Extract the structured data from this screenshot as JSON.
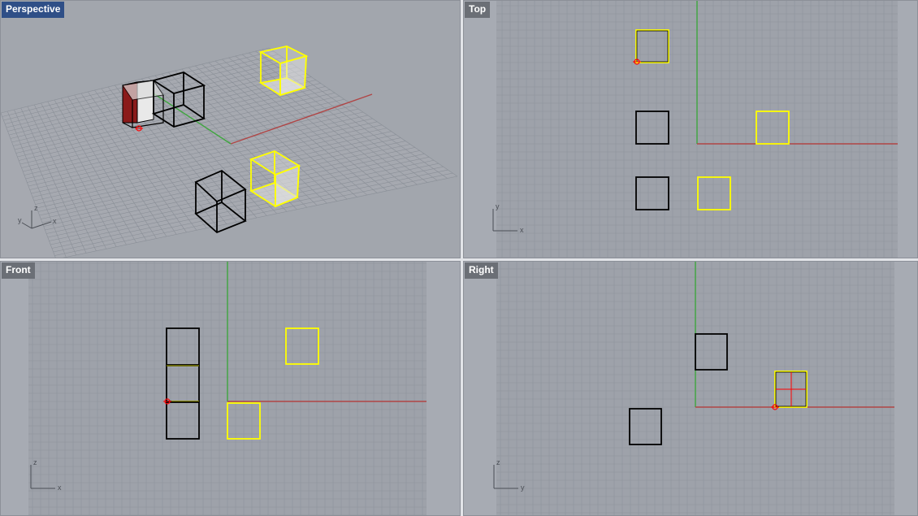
{
  "viewports": {
    "perspective": {
      "title": "Perspective",
      "active": true
    },
    "top": {
      "title": "Top"
    },
    "front": {
      "title": "Front"
    },
    "right": {
      "title": "Right"
    }
  },
  "axis_labels": {
    "perspective": {
      "a": "z",
      "b": "y",
      "c": "x"
    },
    "top": {
      "a": "y",
      "b": "x"
    },
    "front": {
      "a": "z",
      "b": "x"
    },
    "right": {
      "a": "z",
      "b": "y"
    }
  },
  "colors": {
    "grid_line": "#8e939b",
    "grid_major": "#80858d",
    "x_axis": "#b04545",
    "y_axis": "#3ea63e",
    "selected": "#ffff00",
    "unselected": "#000000",
    "active_label_bg": "#2f4f87",
    "viewport_bg": "#9ea2aa",
    "outside_bg": "#a7abb3"
  }
}
